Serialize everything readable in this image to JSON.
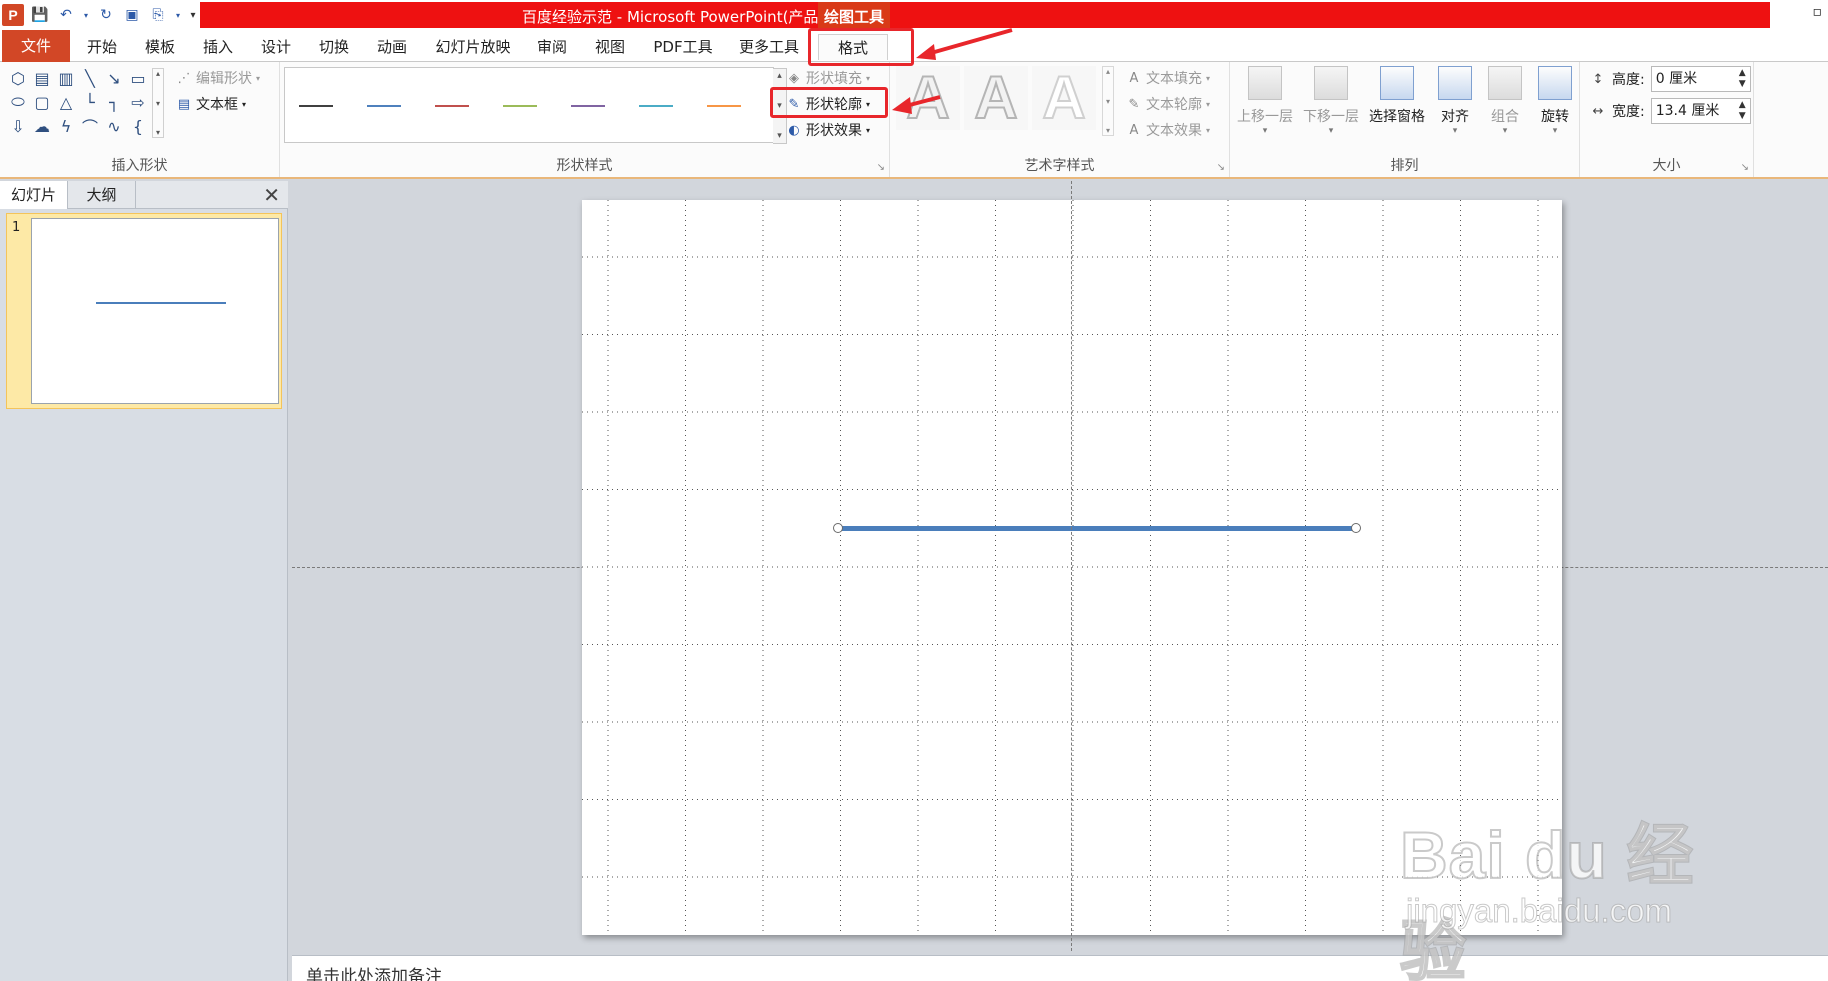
{
  "window": {
    "title": "百度经验示范 - Microsoft PowerPoint(产品激活失败)",
    "context_tab_label": "绘图工具",
    "restore_glyph": "▫"
  },
  "qat": {
    "app_logo": "P",
    "icons": [
      "save-icon",
      "undo-icon",
      "redo-icon",
      "new-slide-icon",
      "copy-format-icon",
      "customize-icon"
    ]
  },
  "tabs": {
    "file": "文件",
    "home": "开始",
    "template": "模板",
    "insert": "插入",
    "design": "设计",
    "transitions": "切换",
    "animations": "动画",
    "slideshow": "幻灯片放映",
    "review": "审阅",
    "view": "视图",
    "pdf": "PDF工具",
    "more_tools": "更多工具",
    "format": "格式"
  },
  "ribbon": {
    "insert_shapes": {
      "label": "插入形状",
      "edit_shape": "编辑形状",
      "textbox": "文本框"
    },
    "shape_styles": {
      "label": "形状样式",
      "fill": "形状填充",
      "outline": "形状轮廓",
      "effects": "形状效果",
      "preset_colors": [
        "#404040",
        "#4f81bd",
        "#c0504d",
        "#9bbb59",
        "#8064a2",
        "#4bacc6",
        "#f79646"
      ]
    },
    "wordart_styles": {
      "label": "艺术字样式",
      "glyph": "A",
      "text_fill": "文本填充",
      "text_outline": "文本轮廓",
      "text_effects": "文本效果"
    },
    "arrange": {
      "label": "排列",
      "bring_forward": "上移一层",
      "send_backward": "下移一层",
      "selection_pane": "选择窗格",
      "align": "对齐",
      "group": "组合",
      "rotate": "旋转"
    },
    "size": {
      "label": "大小",
      "height_label": "高度:",
      "height_value": "0 厘米",
      "width_label": "宽度:",
      "width_value": "13.4 厘米"
    }
  },
  "left_panel": {
    "tab_slides": "幻灯片",
    "tab_outline": "大纲",
    "close": "✕",
    "slide_number": "1"
  },
  "notes": {
    "placeholder": "单击此处添加备注"
  },
  "watermark": {
    "logo": "Bai du 经验",
    "url": "jingyan.baidu.com"
  },
  "colors": {
    "accent_red": "#ee1111",
    "file_tab": "#d24726",
    "line_shape": "#4a7ebb",
    "highlight": "#e8262b"
  }
}
